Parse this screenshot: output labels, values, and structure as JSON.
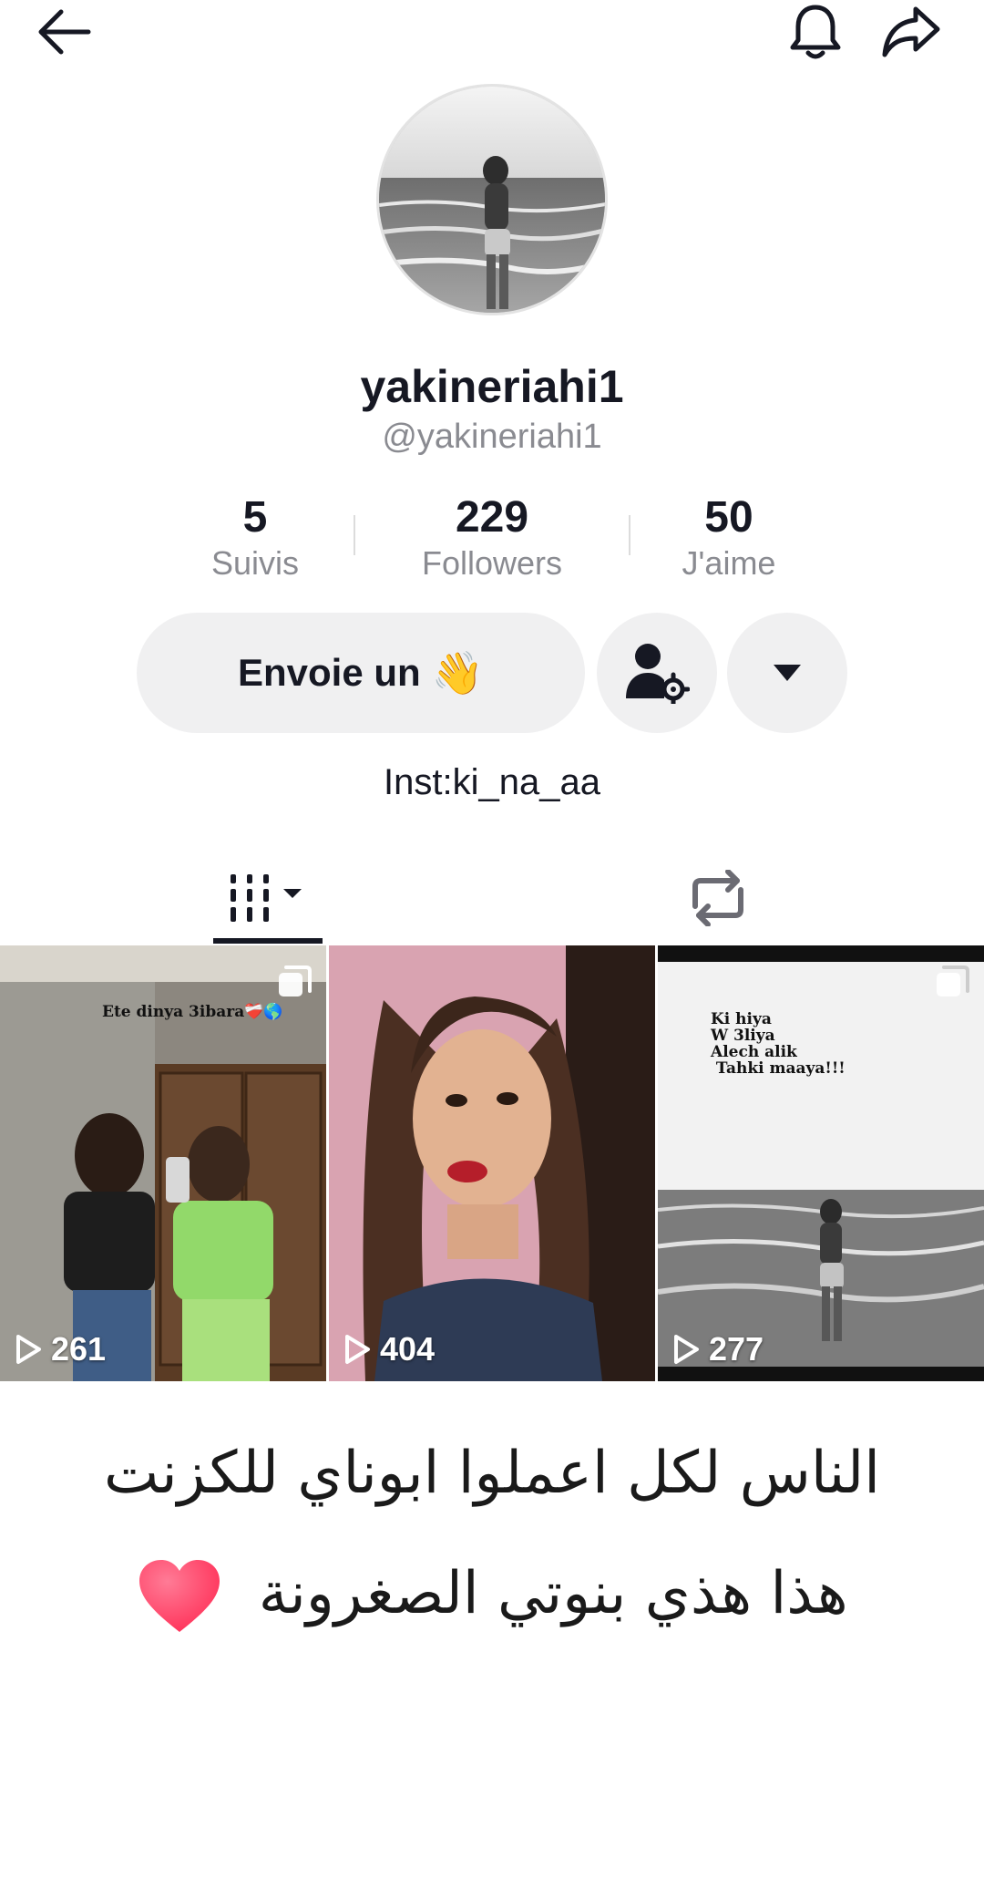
{
  "topbar": {
    "back_icon": "arrow-left-icon",
    "bell_icon": "bell-icon",
    "share_icon": "share-arrow-icon"
  },
  "profile": {
    "display_name": "yakineriahi1",
    "handle": "@yakineriahi1",
    "bio": "Inst:ki_na_aa"
  },
  "stats": {
    "following": {
      "value": "5",
      "label": "Suivis"
    },
    "followers": {
      "value": "229",
      "label": "Followers"
    },
    "likes": {
      "value": "50",
      "label": "J'aime"
    }
  },
  "actions": {
    "send_label": "Envoie un",
    "send_emoji": "👋",
    "add_friend_icon": "user-settings-icon",
    "more_icon": "caret-down-icon"
  },
  "tabs": {
    "videos_icon": "grid-columns-icon",
    "reposts_icon": "repost-icon"
  },
  "videos": [
    {
      "views": "261",
      "overlay": "Ete dinya 3ibara❤️‍🩹🌎",
      "multi": true
    },
    {
      "views": "404",
      "overlay": "",
      "multi": false
    },
    {
      "views": "277",
      "overlay": "Ki hiya\nW 3liya\nAlech alik\n Tahki maaya!!!",
      "multi": true
    }
  ],
  "caption": {
    "line1": "الناس لكل اعملوا ابوناي  للكزنت",
    "line2": "هذا هذي بنوتي الصغرونة"
  },
  "colors": {
    "text": "#161823",
    "muted": "#8a8b91",
    "button_bg": "#f0f0f1",
    "heart": "#ff2d55"
  }
}
